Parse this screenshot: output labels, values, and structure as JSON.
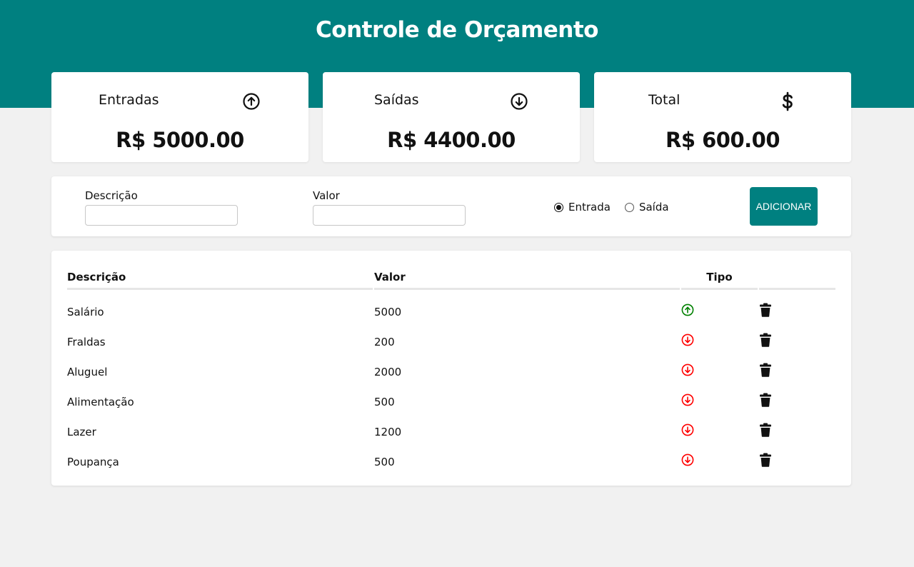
{
  "header": {
    "title": "Controle de Orçamento"
  },
  "summary": {
    "income": {
      "label": "Entradas",
      "value": "R$ 5000.00",
      "icon": "arrow-up-circle-icon"
    },
    "expense": {
      "label": "Saídas",
      "value": "R$ 4400.00",
      "icon": "arrow-down-circle-icon"
    },
    "total": {
      "label": "Total",
      "value": "R$ 600.00",
      "icon": "dollar-icon"
    }
  },
  "form": {
    "description_label": "Descrição",
    "description_value": "",
    "amount_label": "Valor",
    "amount_value": "",
    "type_options": [
      "Entrada",
      "Saída"
    ],
    "type_selected": "Entrada",
    "add_label": "ADICIONAR"
  },
  "table": {
    "headers": [
      "Descrição",
      "Valor",
      "Tipo",
      ""
    ],
    "rows": [
      {
        "description": "Salário",
        "amount": "5000",
        "type": "entrada"
      },
      {
        "description": "Fraldas",
        "amount": "200",
        "type": "saida"
      },
      {
        "description": "Aluguel",
        "amount": "2000",
        "type": "saida"
      },
      {
        "description": "Alimentação",
        "amount": "500",
        "type": "saida"
      },
      {
        "description": "Lazer",
        "amount": "1200",
        "type": "saida"
      },
      {
        "description": "Poupança",
        "amount": "500",
        "type": "saida"
      }
    ]
  },
  "colors": {
    "brand": "#008080",
    "income": "#008000",
    "expense": "#ff0000",
    "background": "#f1f1f1"
  }
}
